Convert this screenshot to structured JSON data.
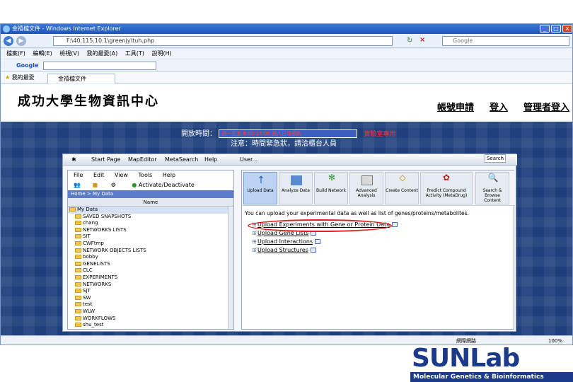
{
  "browser": {
    "title": "金禧檔文件 - Windows Internet Explorer",
    "address": "F:\\40.115.10.1\\greenjy\\tuh.php",
    "search_placeholder": "Google",
    "menu": [
      "檔案(F)",
      "編輯(E)",
      "檢視(V)",
      "我的最愛(A)",
      "工具(T)",
      "說明(H)"
    ],
    "google_label": "Google",
    "favorites_label": "我的最愛",
    "tab_label": "金禧檔文件",
    "status_zone": "網際網路",
    "zoom": "100%"
  },
  "site": {
    "title": "成功大學生物資訊中心",
    "links": [
      "帳號申請",
      "登入",
      "管理者登入"
    ],
    "notice_label": "開放時間：",
    "notice_box": "週一至五 8:00-17:00 週六日請預約",
    "notice_red": "實驗室專用",
    "notice_line2": "注意：時間緊急狀，請洽櫃台人員"
  },
  "app": {
    "top_items": [
      "Start Page",
      "MapEditor",
      "MetaSearch",
      "Help"
    ],
    "user_label": "User...",
    "search_button": "Search",
    "left_menu": [
      "File",
      "Edit",
      "View",
      "Tools",
      "Help"
    ],
    "activate_label": "Activate/Deactivate",
    "breadcrumb": "Home > My Data",
    "column_name": "Name",
    "tree_root": "My Data",
    "tree_items": [
      "SAVED SNAPSHOTS",
      "chang",
      "NETWORKS LISTS",
      "SIT",
      "CWFtmp",
      "NETWORK OBJECTS LISTS",
      "bobby",
      "GENELISTS",
      "CLC",
      "EXPERIMENTS",
      "NETWORKS",
      "SJT",
      "SW",
      "test",
      "WLW",
      "WORKFLOWS",
      "shu_test"
    ],
    "tool_buttons": [
      {
        "label": "Upload Data",
        "icon": "upload-icon"
      },
      {
        "label": "Analyze Data",
        "icon": "analyze-icon"
      },
      {
        "label": "Build Network",
        "icon": "network-icon"
      },
      {
        "label": "Advanced Analysis",
        "icon": "advanced-icon"
      },
      {
        "label": "Create Content",
        "icon": "create-icon"
      },
      {
        "label": "Predict Compound Activity (MetaDrug)",
        "icon": "compound-icon"
      },
      {
        "label": "Search & Browse Content",
        "icon": "search-browse-icon"
      }
    ],
    "intro_text": "You can upload your experimental data as well as list of genes/proteins/metabolites.",
    "upload_items": [
      "Upload Experiments with Gene or Protein Data",
      "Upload Gene Lists",
      "Upload Interactions",
      "Upload Structures"
    ]
  },
  "logo": {
    "word_a": "SUN",
    "word_b": "Lab",
    "subtitle": "Molecular Genetics & Bioinformatics"
  }
}
